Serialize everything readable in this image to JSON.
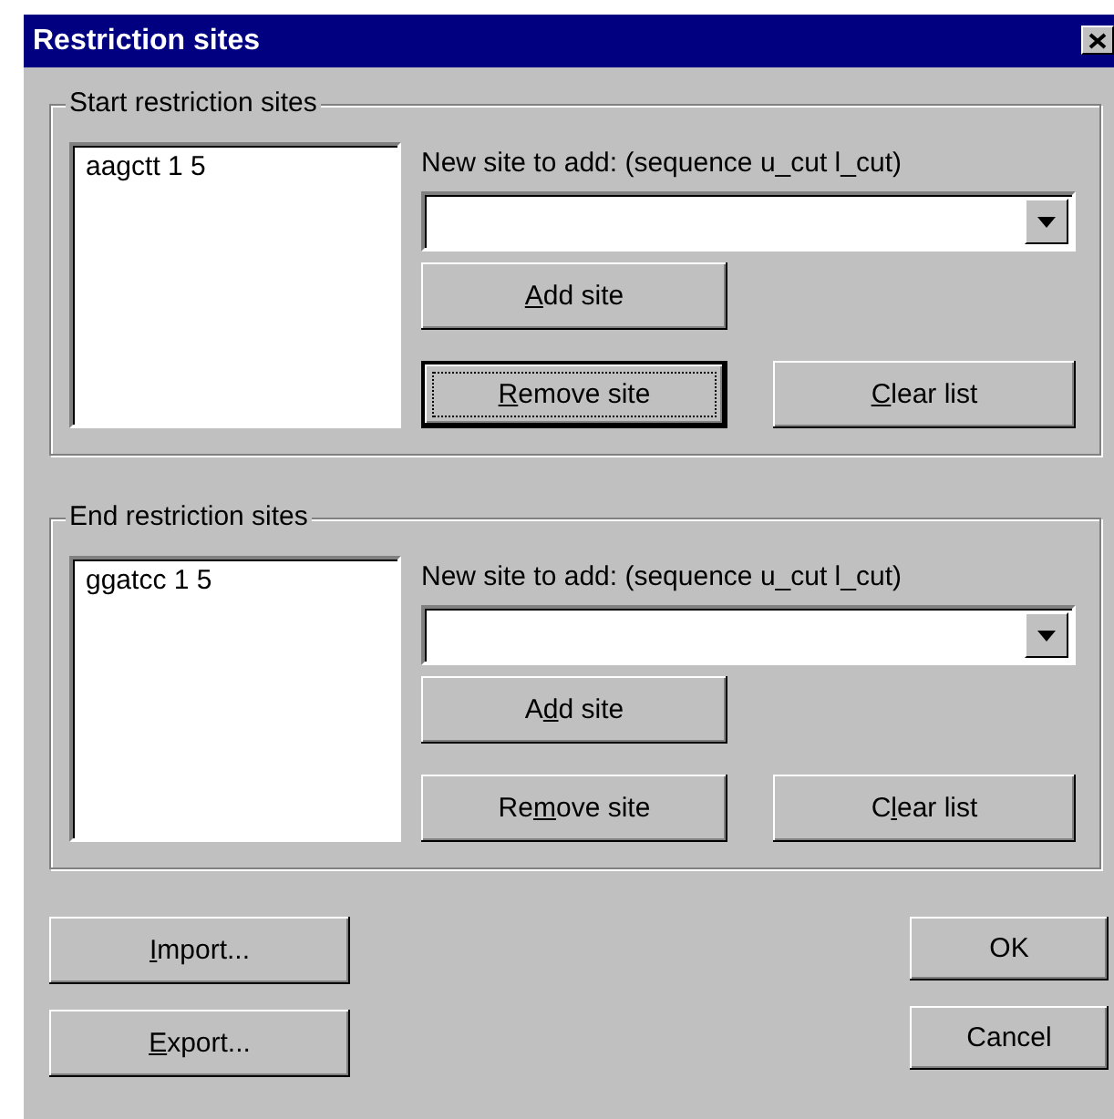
{
  "window": {
    "title": "Restriction sites"
  },
  "groups": [
    {
      "title": "Start restriction sites",
      "list_items": [
        {
          "text": "aagctt 1 5",
          "selected": false
        }
      ],
      "field_label": "New site to add: (sequence u_cut l_cut)",
      "buttons": [
        {
          "kind": "add",
          "label": {
            "key": "A",
            "after": "dd site"
          },
          "focused": false
        },
        {
          "kind": "remove",
          "label": {
            "key": "R",
            "after": "emove site"
          },
          "focused": true
        },
        {
          "kind": "clear",
          "label": {
            "key": "C",
            "after": "lear list"
          },
          "focused": false
        }
      ]
    },
    {
      "title": "End restriction sites",
      "list_items": [
        {
          "text": "ggatcc 1 5",
          "selected": false
        }
      ],
      "field_label": "New site to add: (sequence u_cut l_cut)",
      "buttons": [
        {
          "kind": "add",
          "label": {
            "before": "A",
            "key": "d",
            "after": "d site"
          },
          "focused": false
        },
        {
          "kind": "remove",
          "label": {
            "before": "Re",
            "key": "m",
            "after": "ove site"
          },
          "focused": false
        },
        {
          "kind": "clear",
          "label": {
            "before": "C",
            "key": "l",
            "after": "ear list"
          },
          "focused": false
        }
      ]
    }
  ],
  "footer_left": [
    {
      "label": {
        "key": "I",
        "after": "mport..."
      },
      "focused": false
    },
    {
      "label": {
        "key": "E",
        "after": "xport..."
      },
      "focused": false
    }
  ],
  "footer_right": [
    {
      "label": {
        "before": "OK"
      },
      "focused": false
    },
    {
      "label": {
        "before": "Cancel"
      },
      "focused": false
    }
  ]
}
